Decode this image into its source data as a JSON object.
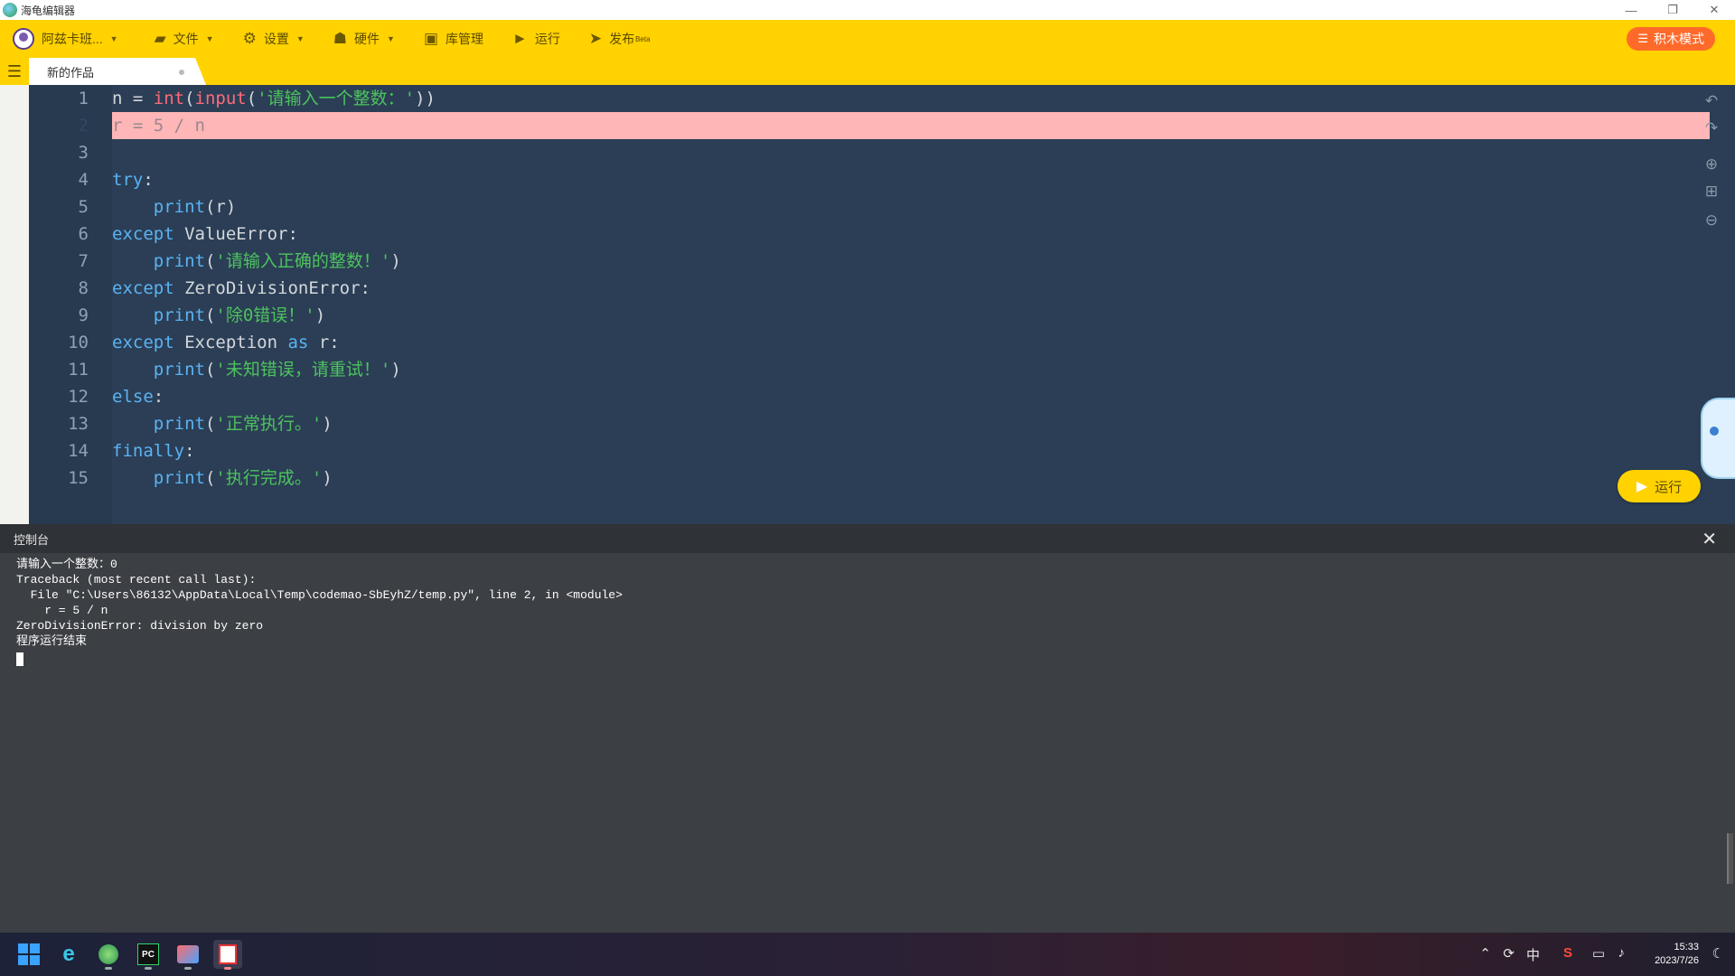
{
  "window": {
    "title": "海龟编辑器",
    "controls": [
      "—",
      "❐",
      "✕"
    ]
  },
  "toolbar": {
    "user": "阿兹卡班...",
    "file": "文件",
    "settings": "设置",
    "hardware": "硬件",
    "library": "库管理",
    "run": "运行",
    "publish": "发布",
    "publish_badge": "Beta",
    "blocks_mode": "积木模式"
  },
  "tab": {
    "label": "新的作品"
  },
  "editor": {
    "error_line": 2,
    "line_numbers": [
      "1",
      "2",
      "3",
      "4",
      "5",
      "6",
      "7",
      "8",
      "9",
      "10",
      "11",
      "12",
      "13",
      "14",
      "15"
    ],
    "run_button": "运行"
  },
  "console": {
    "title": "控制台",
    "close": "✕",
    "lines": [
      "请输入一个整数：0",
      "Traceback (most recent call last):",
      "  File \"C:\\Users\\86132\\AppData\\Local\\Temp\\codemao-SbEyhZ/temp.py\", line 2, in <module>",
      "    r = 5 / n",
      "ZeroDivisionError: division by zero",
      "程序运行结束"
    ]
  },
  "taskbar": {
    "ime": "中",
    "time": "15:33",
    "date": "2023/7/26"
  },
  "colors": {
    "toolbar": "#ffd200",
    "editor_bg": "#2b3e55",
    "error_highlight": "#ffb6b6",
    "blocks_button": "#ff6a2a"
  }
}
